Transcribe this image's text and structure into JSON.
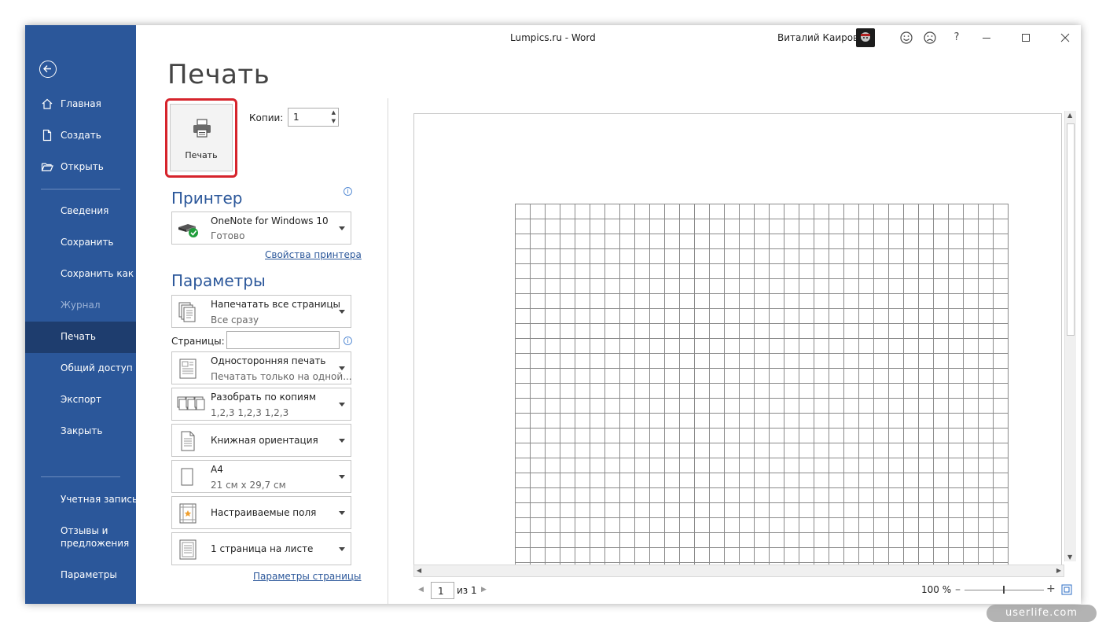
{
  "window": {
    "doc_title": "Lumpics.ru  -  Word",
    "user_name": "Виталий Каиров",
    "title_icons": [
      "smile-icon",
      "frown-icon",
      "help-icon",
      "minimize-icon",
      "maximize-icon",
      "close-icon"
    ],
    "help_label": "?"
  },
  "nav": {
    "items": [
      {
        "label": "Главная",
        "icon": "home-icon"
      },
      {
        "label": "Создать",
        "icon": "new-document-icon"
      },
      {
        "label": "Открыть",
        "icon": "open-folder-icon"
      },
      {
        "label": "Сведения"
      },
      {
        "label": "Сохранить"
      },
      {
        "label": "Сохранить как"
      },
      {
        "label": "Журнал"
      },
      {
        "label": "Печать"
      },
      {
        "label": "Общий доступ"
      },
      {
        "label": "Экспорт"
      },
      {
        "label": "Закрыть"
      },
      {
        "label": "Учетная запись"
      },
      {
        "label": "Отзывы и"
      },
      {
        "label": "предложения"
      },
      {
        "label": "Параметры"
      }
    ]
  },
  "print": {
    "page_title": "Печать",
    "print_button": "Печать",
    "copies_label": "Копии:",
    "copies_value": "1",
    "printer_heading": "Принтер",
    "printer_name": "OneNote for Windows 10",
    "printer_status": "Готово",
    "printer_props_link": "Свойства принтера",
    "settings_heading": "Параметры",
    "settings": [
      {
        "line1": "Напечатать все страницы",
        "line2": "Все сразу",
        "icon": "pages-icon"
      },
      {
        "line1": "Односторонняя печать",
        "line2": "Печатать только на одной...",
        "icon": "one-sided-icon"
      },
      {
        "line1": "Разобрать по копиям",
        "line2": "1,2,3    1,2,3    1,2,3",
        "icon": "collate-icon"
      },
      {
        "line1": "Книжная ориентация",
        "line2": "",
        "icon": "portrait-icon"
      },
      {
        "line1": "A4",
        "line2": "21 см x 29,7 см",
        "icon": "paper-size-icon"
      },
      {
        "line1": "Настраиваемые поля",
        "line2": "",
        "icon": "margins-icon"
      },
      {
        "line1": "1 страница на листе",
        "line2": "",
        "icon": "pages-per-sheet-icon"
      }
    ],
    "pages_label": "Страницы:",
    "pages_value": "",
    "page_setup_link": "Параметры страницы"
  },
  "status": {
    "page_current": "1",
    "page_of": "из 1",
    "zoom": "100 %"
  },
  "preview": {
    "grid_cols": 33,
    "grid_rows": 26
  },
  "watermark": "userlife.com"
}
